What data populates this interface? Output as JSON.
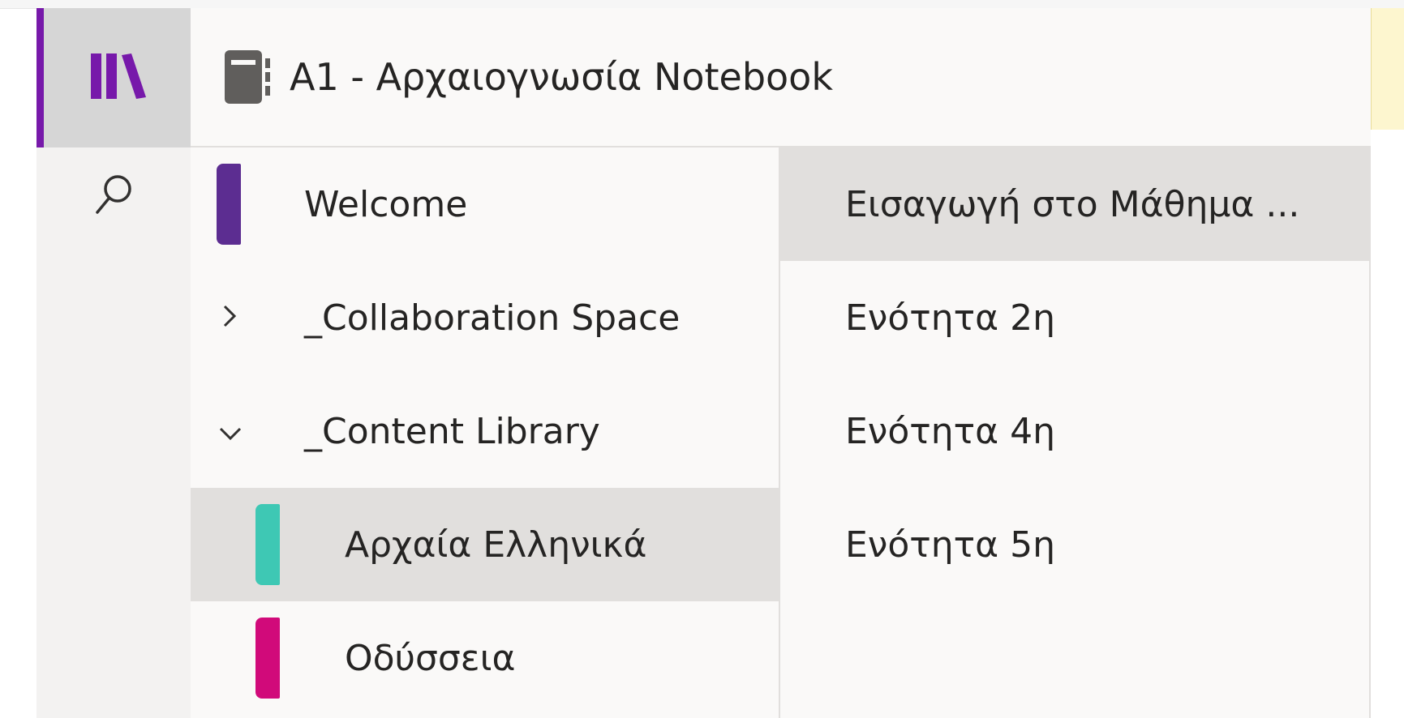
{
  "rail": {
    "notebooks_icon": "notebooks-library-icon",
    "search_icon": "search-icon",
    "accent_color": "#7719aa"
  },
  "header": {
    "notebook_icon": "notebook-icon",
    "title": "A1 - Αρχαιογνωσία Notebook"
  },
  "sections": [
    {
      "label": "Welcome",
      "type": "section",
      "color": "#5c2d91",
      "selected": false
    },
    {
      "label": "_Collaboration Space",
      "type": "group",
      "expanded": false,
      "icon": "chevron-right-icon"
    },
    {
      "label": "_Content Library",
      "type": "group",
      "expanded": true,
      "icon": "chevron-down-icon"
    },
    {
      "label": "Αρχαία Ελληνικά",
      "type": "section",
      "color": "#3ec8b4",
      "selected": true
    },
    {
      "label": "Οδύσσεια",
      "type": "section",
      "color": "#d10a7a",
      "selected": false
    }
  ],
  "pages": [
    {
      "label": "Εισαγωγή στο Μάθημα ...",
      "selected": true
    },
    {
      "label": "Ενότητα 2η",
      "selected": false
    },
    {
      "label": "Ενότητα 4η",
      "selected": false
    },
    {
      "label": "Ενότητα 5η",
      "selected": false
    }
  ]
}
